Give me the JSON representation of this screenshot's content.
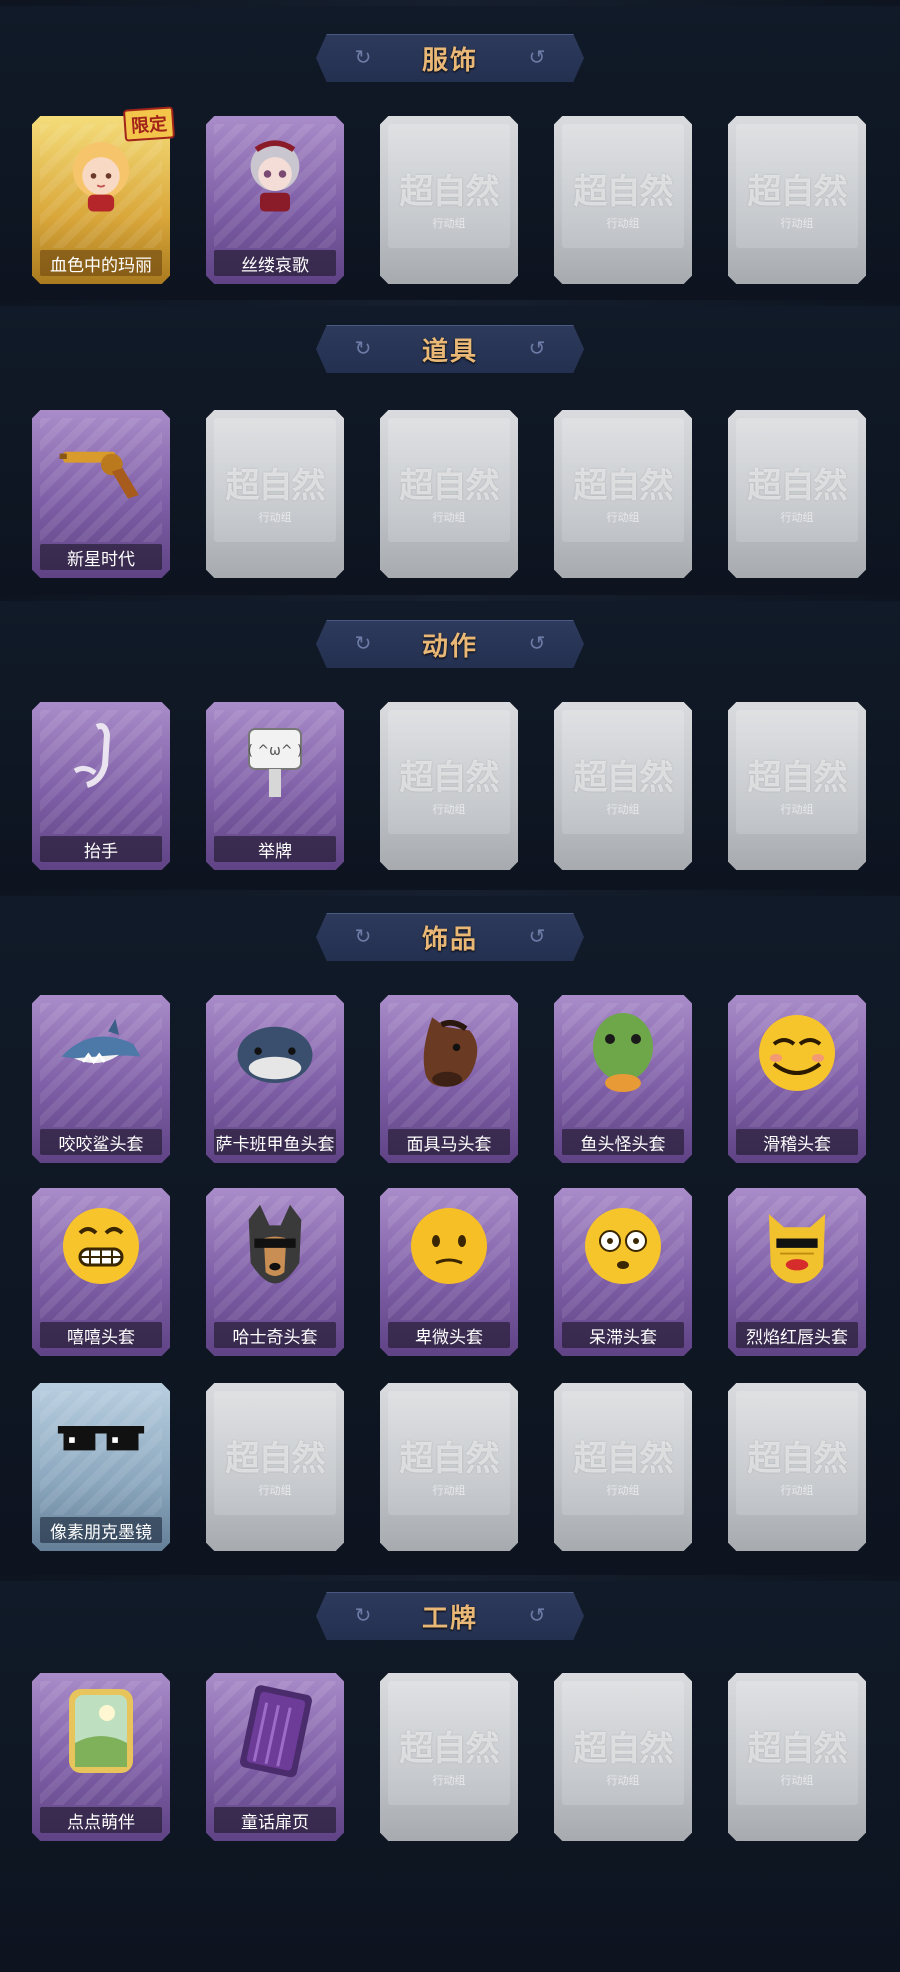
{
  "sections": [
    {
      "title": "服饰",
      "rows": [
        [
          {
            "label": "血色中的玛丽",
            "style": "gold",
            "badge": "限定",
            "icon": "character-mary-icon"
          },
          {
            "label": "丝缕哀歌",
            "style": "purple",
            "icon": "character-silk-icon"
          },
          {
            "locked": true
          },
          {
            "locked": true
          },
          {
            "locked": true
          }
        ]
      ]
    },
    {
      "title": "道具",
      "rows": [
        [
          {
            "label": "新星时代",
            "style": "purple",
            "icon": "revolver-icon"
          },
          {
            "locked": true
          },
          {
            "locked": true
          },
          {
            "locked": true
          },
          {
            "locked": true
          }
        ]
      ]
    },
    {
      "title": "动作",
      "rows": [
        [
          {
            "label": "抬手",
            "style": "purple",
            "icon": "raise-hand-icon"
          },
          {
            "label": "举牌",
            "style": "purple",
            "icon": "hold-sign-icon"
          },
          {
            "locked": true
          },
          {
            "locked": true
          },
          {
            "locked": true
          }
        ]
      ]
    },
    {
      "title": "饰品",
      "rows": [
        [
          {
            "label": "咬咬鲨头套",
            "style": "purple",
            "icon": "shark-head-icon"
          },
          {
            "label": "萨卡班甲鱼头套",
            "style": "purple",
            "icon": "fish-head-icon"
          },
          {
            "label": "面具马头套",
            "style": "purple",
            "icon": "horse-head-icon"
          },
          {
            "label": "鱼头怪头套",
            "style": "purple",
            "icon": "fish-monster-head-icon"
          },
          {
            "label": "滑稽头套",
            "style": "purple",
            "icon": "funny-face-icon"
          }
        ],
        [
          {
            "label": "嘻嘻头套",
            "style": "purple",
            "icon": "grin-face-icon"
          },
          {
            "label": "哈士奇头套",
            "style": "purple",
            "icon": "husky-head-icon"
          },
          {
            "label": "卑微头套",
            "style": "purple",
            "icon": "humble-face-icon"
          },
          {
            "label": "呆滞头套",
            "style": "purple",
            "icon": "dazed-face-icon"
          },
          {
            "label": "烈焰红唇头套",
            "style": "purple",
            "icon": "red-lips-head-icon"
          }
        ],
        [
          {
            "label": "像素朋克墨镜",
            "style": "blue",
            "icon": "pixel-sunglasses-icon"
          },
          {
            "locked": true
          },
          {
            "locked": true
          },
          {
            "locked": true
          },
          {
            "locked": true
          }
        ]
      ]
    },
    {
      "title": "工牌",
      "rows": [
        [
          {
            "label": "点点萌伴",
            "style": "purple",
            "icon": "badge-landscape-icon"
          },
          {
            "label": "童话扉页",
            "style": "purple",
            "icon": "badge-book-icon"
          },
          {
            "locked": true
          },
          {
            "locked": true
          },
          {
            "locked": true
          }
        ]
      ]
    }
  ],
  "locked_card": {
    "logo": "超自然",
    "sub": "行动组"
  },
  "colors": {
    "accent": "#e9b877",
    "background": "#0e1520",
    "banner": "#2e3a5c"
  }
}
